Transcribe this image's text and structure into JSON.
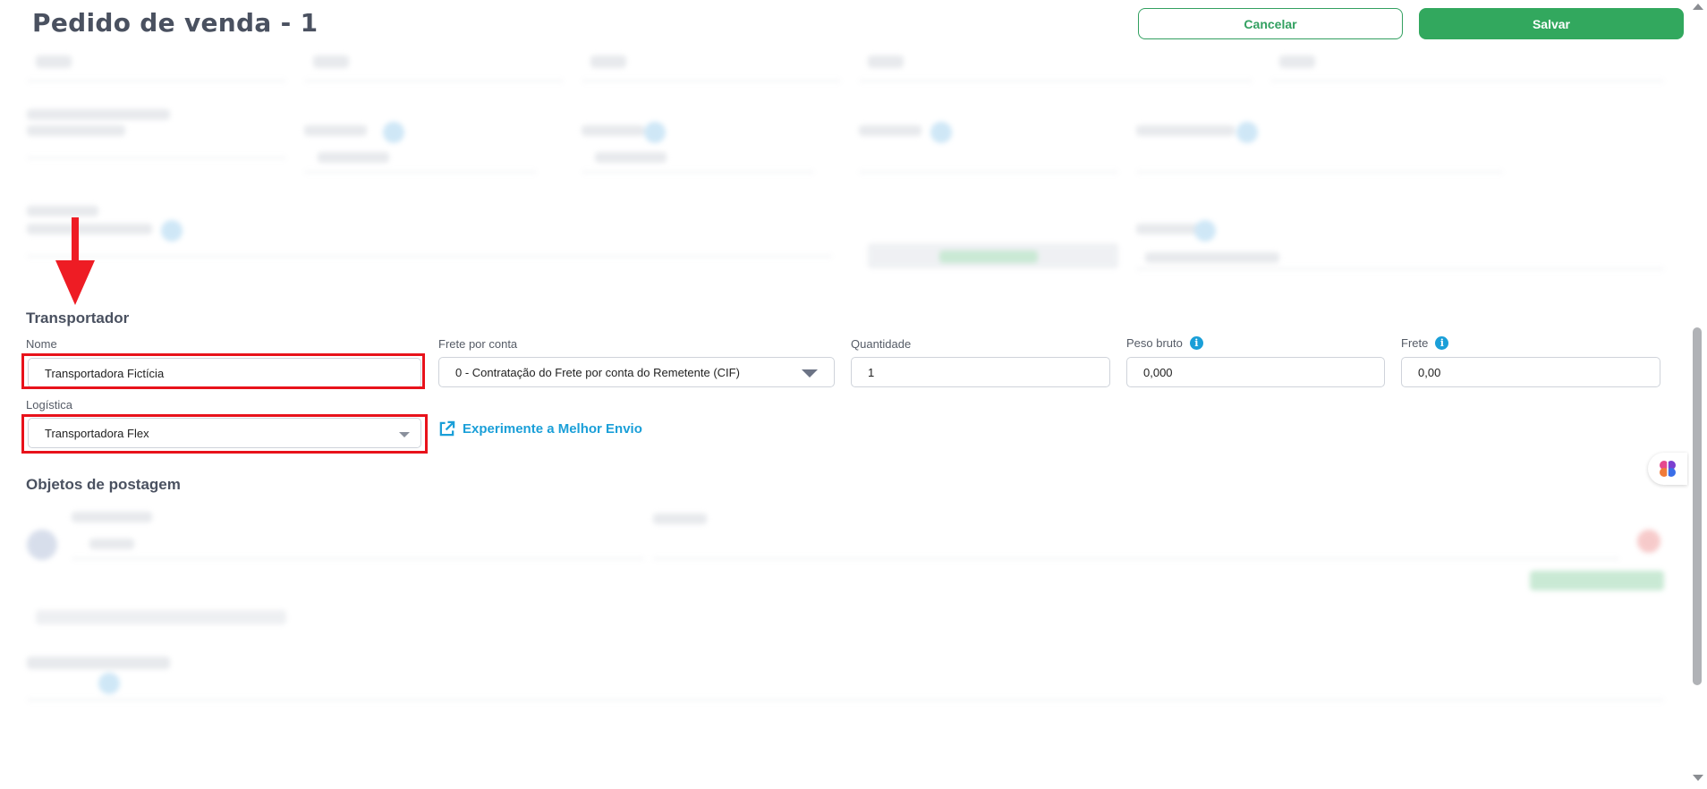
{
  "header": {
    "title": "Pedido de venda - 1",
    "cancel_label": "Cancelar",
    "save_label": "Salvar"
  },
  "transportador": {
    "section_title": "Transportador",
    "nome": {
      "label": "Nome",
      "value": "Transportadora Fictícia"
    },
    "frete_por_conta": {
      "label": "Frete por conta",
      "value": "0 - Contratação do Frete por conta do Remetente (CIF)"
    },
    "quantidade": {
      "label": "Quantidade",
      "value": "1"
    },
    "peso_bruto": {
      "label": "Peso bruto",
      "value": "0,000"
    },
    "frete": {
      "label": "Frete",
      "value": "0,00"
    },
    "logistica": {
      "label": "Logística",
      "value": "Transportadora Flex"
    },
    "melhor_envio_link": "Experimente a Melhor Envio"
  },
  "objetos": {
    "section_title": "Objetos de postagem"
  },
  "colors": {
    "accent_green": "#32a85e",
    "link_blue": "#1a9fd8",
    "highlight_red": "#e8121b"
  },
  "icons": {
    "info": "info-icon",
    "external": "external-link-icon",
    "assistant": "brain-icon",
    "annotation": "red-arrow-annotation"
  }
}
